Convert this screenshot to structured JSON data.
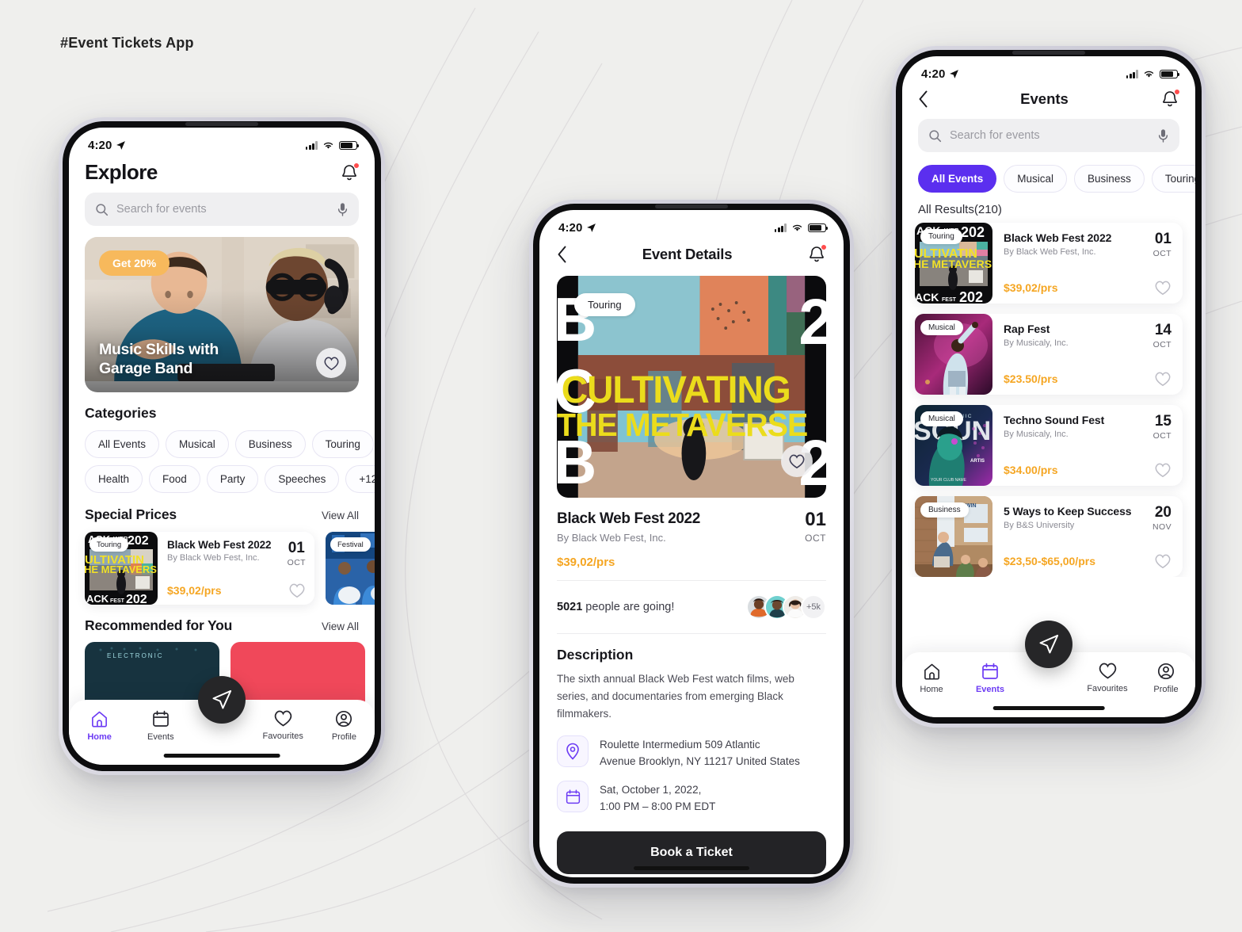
{
  "page": {
    "label": "#Event Tickets App",
    "bg": "#efefed",
    "accent": "#5b2fef",
    "price_color": "#f5a623"
  },
  "status_bar": {
    "time": "4:20"
  },
  "phone1": {
    "title": "Explore",
    "search": {
      "placeholder": "Search for events"
    },
    "hero": {
      "badge": "Get 20%",
      "title_line1": "Music Skills with",
      "title_line2": "Garage Band"
    },
    "categories": {
      "heading": "Categories",
      "row1": [
        "All Events",
        "Musical",
        "Business",
        "Touring"
      ],
      "row2": [
        "Health",
        "Food",
        "Party",
        "Speeches",
        "+12"
      ]
    },
    "special": {
      "heading": "Special Prices",
      "view_all": "View All",
      "cards": [
        {
          "badge": "Touring",
          "title": "Black Web Fest 2022",
          "by": "By Black Web Fest, Inc.",
          "price": "$39,02/prs",
          "day": "01",
          "month": "OCT"
        },
        {
          "badge": "Festival",
          "title": "",
          "by": "",
          "price": "",
          "day": "",
          "month": ""
        }
      ]
    },
    "recommended": {
      "heading": "Recommended for You",
      "view_all": "View All"
    },
    "tabbar": [
      {
        "label": "Home",
        "icon": "home-icon",
        "active": true
      },
      {
        "label": "Events",
        "icon": "calendar-icon",
        "active": false
      },
      {
        "label": "Favourites",
        "icon": "heart-icon",
        "active": false
      },
      {
        "label": "Profile",
        "icon": "user-icon",
        "active": false
      }
    ]
  },
  "phone2": {
    "nav_title": "Event Details",
    "hero": {
      "badge": "Touring",
      "poster_line1": "CULTIVATING",
      "poster_line2": "THE METAVERSE"
    },
    "event": {
      "title": "Black Web Fest 2022",
      "by": "By Black Web Fest, Inc.",
      "price": "$39,02/prs",
      "day": "01",
      "month": "OCT"
    },
    "going": {
      "count": "5021",
      "text": " people are going!",
      "more": "+5k"
    },
    "description": {
      "heading": "Description",
      "body": "The sixth annual Black Web Fest watch films, web series, and documentaries from emerging Black filmmakers."
    },
    "meta": [
      {
        "icon": "location-pin-icon",
        "line1": "Roulette Intermedium 509 Atlantic",
        "line2": "Avenue Brooklyn, NY 11217 United States"
      },
      {
        "icon": "calendar-icon",
        "line1": "Sat, October 1, 2022,",
        "line2": "1:00 PM – 8:00 PM EDT"
      }
    ],
    "cta": "Book a Ticket"
  },
  "phone3": {
    "nav_title": "Events",
    "search": {
      "placeholder": "Search for events"
    },
    "chips": [
      "All Events",
      "Musical",
      "Business",
      "Touring"
    ],
    "results_label": "All Results(210)",
    "items": [
      {
        "badge": "Touring",
        "title": "Black Web Fest 2022",
        "by": "By Black Web Fest, Inc.",
        "price": "$39,02/prs",
        "day": "01",
        "month": "OCT"
      },
      {
        "badge": "Musical",
        "title": "Rap Fest",
        "by": "By Musicaly, Inc.",
        "price": "$23.50/prs",
        "day": "14",
        "month": "OCT"
      },
      {
        "badge": "Musical",
        "title": "Techno Sound Fest",
        "by": "By Musicaly, Inc.",
        "price": "$34.00/prs",
        "day": "15",
        "month": "OCT"
      },
      {
        "badge": "Business",
        "title": "5 Ways to Keep Success",
        "by": "By B&S University",
        "price": "$23,50-$65,00/prs",
        "day": "20",
        "month": "NOV"
      }
    ],
    "tabbar": [
      {
        "label": "Home",
        "icon": "home-icon",
        "active": false
      },
      {
        "label": "Events",
        "icon": "calendar-icon",
        "active": true
      },
      {
        "label": "Favourites",
        "icon": "heart-icon",
        "active": false
      },
      {
        "label": "Profile",
        "icon": "user-icon",
        "active": false
      }
    ]
  }
}
